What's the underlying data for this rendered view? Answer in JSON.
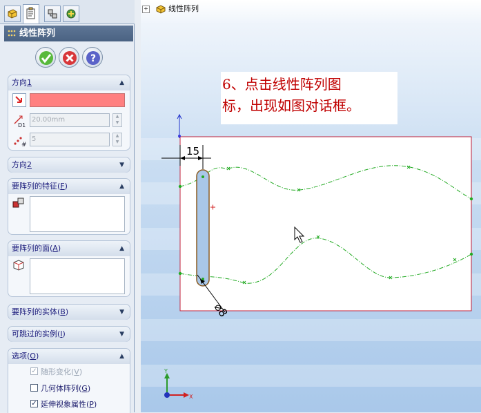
{
  "feature_manager": {
    "title": "线性阵列",
    "tabs": [
      "feature-manager-tab",
      "property-manager-tab",
      "configuration-manager-tab",
      "dimxpert-manager-tab"
    ],
    "buttons": {
      "ok": "ok-check-icon",
      "cancel": "cancel-x-icon",
      "help": "help-question-icon"
    },
    "direction1": {
      "label": "方向",
      "number": "1",
      "distance": "20.00mm",
      "instances": "5"
    },
    "direction2": {
      "label": "方向",
      "number": "2"
    },
    "features_to_pattern": {
      "label": "要阵列的特征(",
      "key": "F",
      "close": ")"
    },
    "faces_to_pattern": {
      "label": "要阵列的面(",
      "key": "A",
      "close": ")"
    },
    "bodies_to_pattern": {
      "label": "要阵列的实体(",
      "key": "B",
      "close": ")"
    },
    "instances_to_skip": {
      "label": "可跳过的实例(",
      "key": "I",
      "close": ")"
    },
    "options": {
      "label": "选项(",
      "key": "O",
      "close": ")",
      "vary_sketch": {
        "label": "随形变化(",
        "key": "V",
        "close": ")",
        "checked": true,
        "disabled": true
      },
      "geometry_pattern": {
        "label": "几何体阵列(",
        "key": "G",
        "close": ")",
        "checked": false
      },
      "propagate_visual": {
        "label": "延伸视象属性(",
        "key": "P",
        "close": ")",
        "checked": true
      }
    },
    "colors": {
      "selection_box": "#ff8080",
      "header": "#4f6787"
    }
  },
  "graphics": {
    "tree_item": "线性阵列",
    "annotation_line1": "6、点击线性阵列图",
    "annotation_line2": "标，出现如图对话框。",
    "dimension_linear": "15",
    "dimension_diameter": "⌀8",
    "axis_y": "Y",
    "axis_x": "X",
    "colors": {
      "sketch_curve": "#22aa22",
      "rectangle": "#c0203a",
      "annotation": "#c00000"
    }
  }
}
